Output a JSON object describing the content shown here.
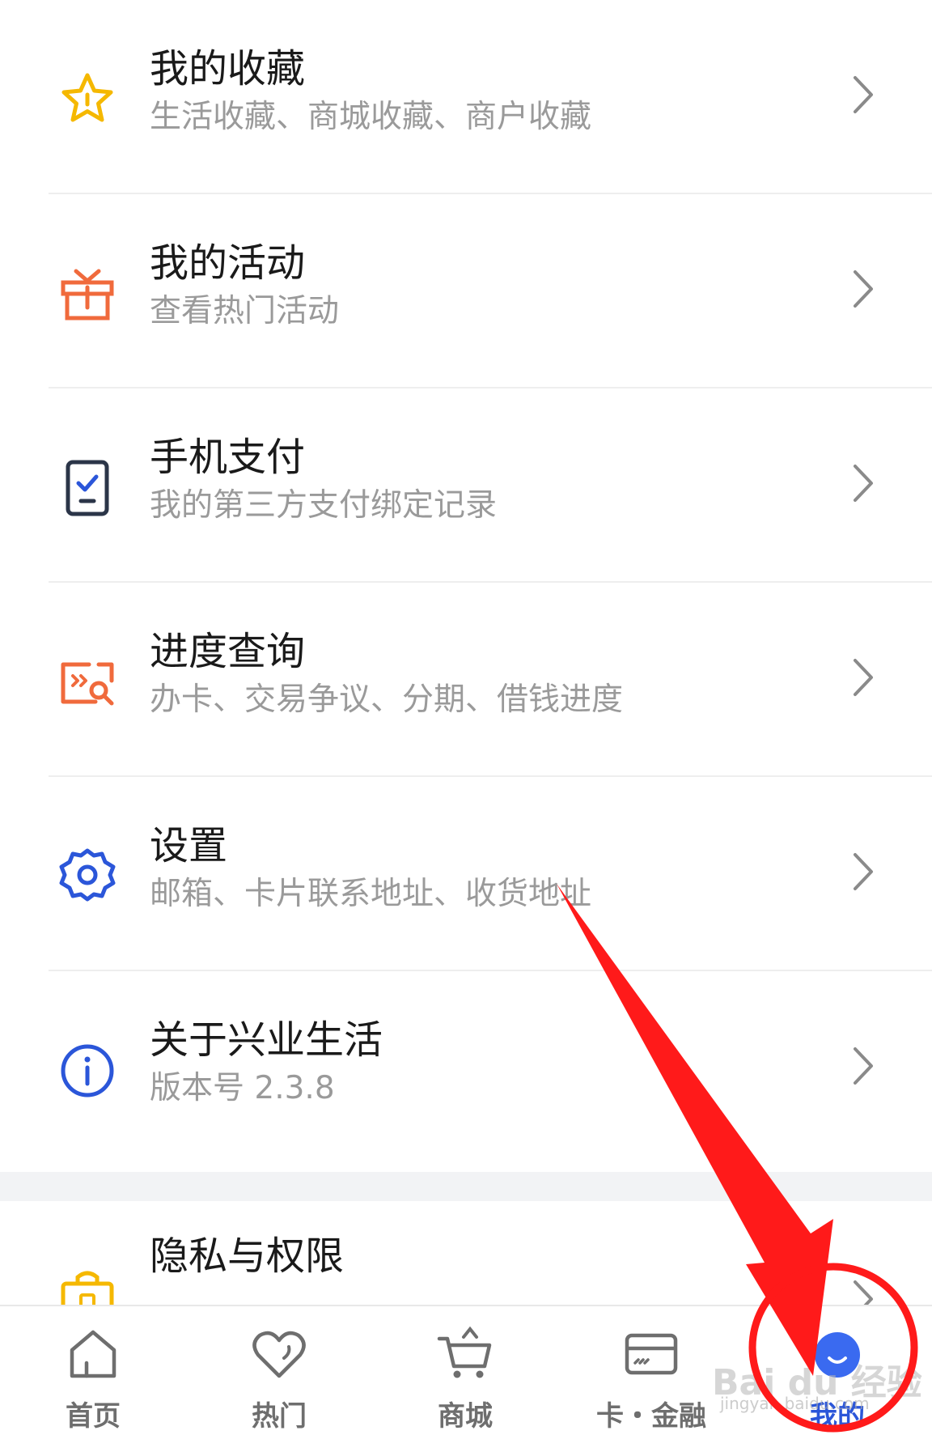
{
  "menu": {
    "items": [
      {
        "title": "我的收藏",
        "subtitle": "生活收藏、商城收藏、商户收藏",
        "icon": "star-icon",
        "color": "#f5b800"
      },
      {
        "title": "我的活动",
        "subtitle": "查看热门活动",
        "icon": "gift-icon",
        "color": "#f06a3c"
      },
      {
        "title": "手机支付",
        "subtitle": "我的第三方支付绑定记录",
        "icon": "phone-pay-icon",
        "color": "#2b3548"
      },
      {
        "title": "进度查询",
        "subtitle": "办卡、交易争议、分期、借钱进度",
        "icon": "progress-search-icon",
        "color": "#f06a3c"
      },
      {
        "title": "设置",
        "subtitle": "邮箱、卡片联系地址、收货地址",
        "icon": "gear-icon",
        "color": "#2b56d9"
      },
      {
        "title": "关于兴业生活",
        "subtitle": "版本号 2.3.8",
        "icon": "info-icon",
        "color": "#2b56d9"
      },
      {
        "title": "隐私与权限",
        "subtitle": "",
        "icon": "lock-icon",
        "color": "#f5b800"
      }
    ]
  },
  "tabbar": {
    "tabs": [
      {
        "label": "首页",
        "icon": "home-icon"
      },
      {
        "label": "热门",
        "icon": "heart-icon"
      },
      {
        "label": "商城",
        "icon": "cart-icon"
      },
      {
        "label": "卡・金融",
        "icon": "card-icon"
      },
      {
        "label": "我的",
        "icon": "profile-icon",
        "active": true
      }
    ],
    "active_color": "#2b56d9",
    "inactive_color": "#6e6e6e"
  },
  "watermark": {
    "text": "Bai du 经验",
    "sub": "jingyan.baidu.com"
  },
  "annotation_color": "#ff1a1a"
}
